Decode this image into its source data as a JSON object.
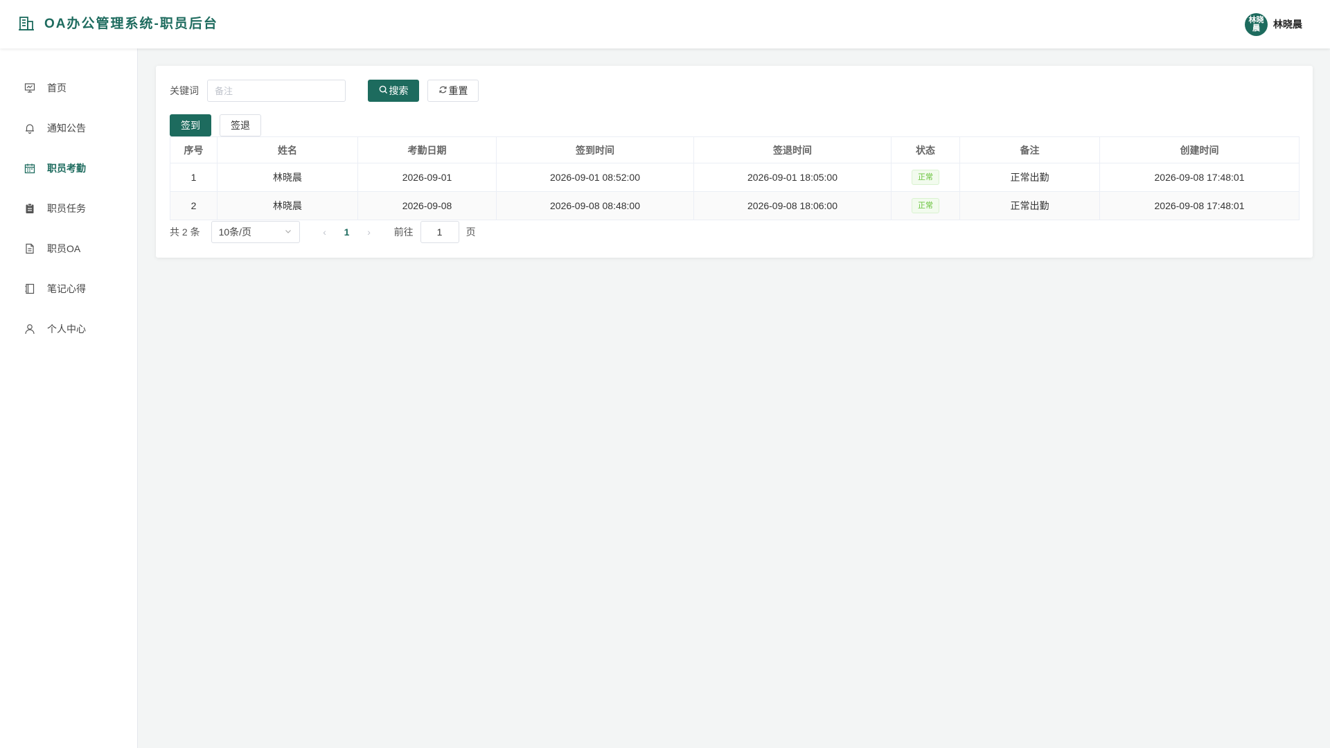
{
  "header": {
    "app_title": "OA办公管理系统-职员后台",
    "user": {
      "avatar_text": "林晓晨",
      "name": "林晓晨"
    }
  },
  "sidebar": {
    "items": [
      {
        "label": "首页",
        "icon": "presentation-icon",
        "active": false
      },
      {
        "label": "通知公告",
        "icon": "bell-icon",
        "active": false
      },
      {
        "label": "职员考勤",
        "icon": "calendar-icon",
        "active": true
      },
      {
        "label": "职员任务",
        "icon": "clipboard-icon",
        "active": false
      },
      {
        "label": "职员OA",
        "icon": "document-icon",
        "active": false
      },
      {
        "label": "笔记心得",
        "icon": "notebook-icon",
        "active": false
      },
      {
        "label": "个人中心",
        "icon": "user-icon",
        "active": false
      }
    ]
  },
  "filter": {
    "keyword_label": "关键词",
    "keyword_value": "",
    "keyword_placeholder": "备注",
    "search_label": "搜索",
    "reset_label": "重置"
  },
  "actions": {
    "signin_label": "签到",
    "signout_label": "签退"
  },
  "table": {
    "columns": [
      "序号",
      "姓名",
      "考勤日期",
      "签到时间",
      "签退时间",
      "状态",
      "备注",
      "创建时间"
    ],
    "rows": [
      {
        "index": "1",
        "name": "林晓晨",
        "date": "2026-09-01",
        "signin": "2026-09-01 08:52:00",
        "signout": "2026-09-01 18:05:00",
        "status": "正常",
        "remark": "正常出勤",
        "created": "2026-09-08 17:48:01"
      },
      {
        "index": "2",
        "name": "林晓晨",
        "date": "2026-09-08",
        "signin": "2026-09-08 08:48:00",
        "signout": "2026-09-08 18:06:00",
        "status": "正常",
        "remark": "正常出勤",
        "created": "2026-09-08 17:48:01"
      }
    ]
  },
  "pagination": {
    "total_text": "共 2 条",
    "page_size": "10条/页",
    "current_page": "1",
    "goto_prefix": "前往",
    "goto_value": "1",
    "goto_suffix": "页"
  },
  "colors": {
    "brand": "#1d6b5e",
    "status_ok": "#67c23a"
  }
}
